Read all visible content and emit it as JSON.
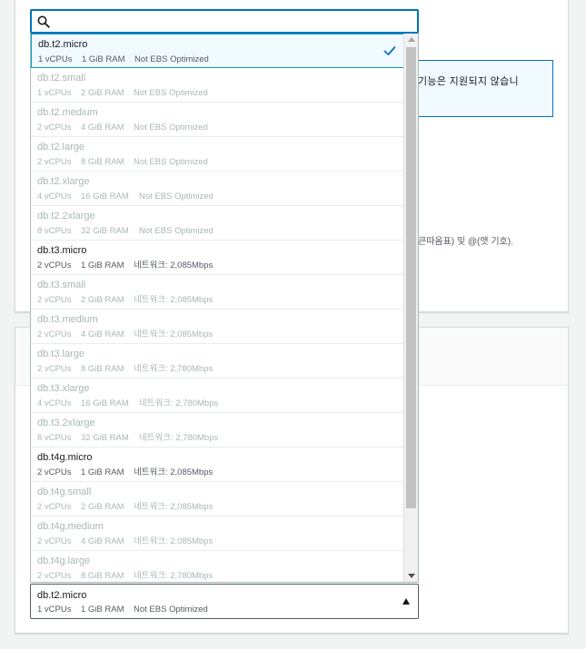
{
  "background": {
    "info_text": "기능은 지원되지 않습니",
    "hint_text": "큰따옴표) 및 @(앳 기호)."
  },
  "search": {
    "value": "",
    "placeholder": ""
  },
  "options": [
    {
      "name": "db.t2.micro",
      "vcpu": "1 vCPUs",
      "ram": "1 GiB RAM",
      "extra": "Not EBS Optimized",
      "disabled": false,
      "selected": true
    },
    {
      "name": "db.t2.small",
      "vcpu": "1 vCPUs",
      "ram": "2 GiB RAM",
      "extra": "Not EBS Optimized",
      "disabled": true,
      "selected": false
    },
    {
      "name": "db.t2.medium",
      "vcpu": "2 vCPUs",
      "ram": "4 GiB RAM",
      "extra": "Not EBS Optimized",
      "disabled": true,
      "selected": false
    },
    {
      "name": "db.t2.large",
      "vcpu": "2 vCPUs",
      "ram": "8 GiB RAM",
      "extra": "Not EBS Optimized",
      "disabled": true,
      "selected": false
    },
    {
      "name": "db.t2.xlarge",
      "vcpu": "4 vCPUs",
      "ram": "16 GiB RAM",
      "extra": "Not EBS Optimized",
      "disabled": true,
      "selected": false
    },
    {
      "name": "db.t2.2xlarge",
      "vcpu": "8 vCPUs",
      "ram": "32 GiB RAM",
      "extra": "Not EBS Optimized",
      "disabled": true,
      "selected": false
    },
    {
      "name": "db.t3.micro",
      "vcpu": "2 vCPUs",
      "ram": "1 GiB RAM",
      "extra": "네트워크: 2,085Mbps",
      "disabled": false,
      "selected": false
    },
    {
      "name": "db.t3.small",
      "vcpu": "2 vCPUs",
      "ram": "2 GiB RAM",
      "extra": "네트워크: 2,085Mbps",
      "disabled": true,
      "selected": false
    },
    {
      "name": "db.t3.medium",
      "vcpu": "2 vCPUs",
      "ram": "4 GiB RAM",
      "extra": "네트워크: 2,085Mbps",
      "disabled": true,
      "selected": false
    },
    {
      "name": "db.t3.large",
      "vcpu": "2 vCPUs",
      "ram": "8 GiB RAM",
      "extra": "네트워크: 2,780Mbps",
      "disabled": true,
      "selected": false
    },
    {
      "name": "db.t3.xlarge",
      "vcpu": "4 vCPUs",
      "ram": "16 GiB RAM",
      "extra": "네트워크: 2,780Mbps",
      "disabled": true,
      "selected": false
    },
    {
      "name": "db.t3.2xlarge",
      "vcpu": "8 vCPUs",
      "ram": "32 GiB RAM",
      "extra": "네트워크: 2,780Mbps",
      "disabled": true,
      "selected": false
    },
    {
      "name": "db.t4g.micro",
      "vcpu": "2 vCPUs",
      "ram": "1 GiB RAM",
      "extra": "네트워크: 2,085Mbps",
      "disabled": false,
      "selected": false
    },
    {
      "name": "db.t4g.small",
      "vcpu": "2 vCPUs",
      "ram": "2 GiB RAM",
      "extra": "네트워크: 2,085Mbps",
      "disabled": true,
      "selected": false
    },
    {
      "name": "db.t4g.medium",
      "vcpu": "2 vCPUs",
      "ram": "4 GiB RAM",
      "extra": "네트워크: 2,085Mbps",
      "disabled": true,
      "selected": false
    },
    {
      "name": "db.t4g.large",
      "vcpu": "2 vCPUs",
      "ram": "8 GiB RAM",
      "extra": "네트워크: 2,780Mbps",
      "disabled": true,
      "selected": false
    }
  ],
  "selected": {
    "name": "db.t2.micro",
    "vcpu": "1 vCPUs",
    "ram": "1 GiB RAM",
    "extra": "Not EBS Optimized"
  },
  "icons": {
    "search": "search-icon",
    "check": "check-icon",
    "caret": "caret-up-icon"
  },
  "colors": {
    "accent": "#0073bb",
    "selected_bg": "#f1faff",
    "disabled_text": "#aab7b8"
  }
}
